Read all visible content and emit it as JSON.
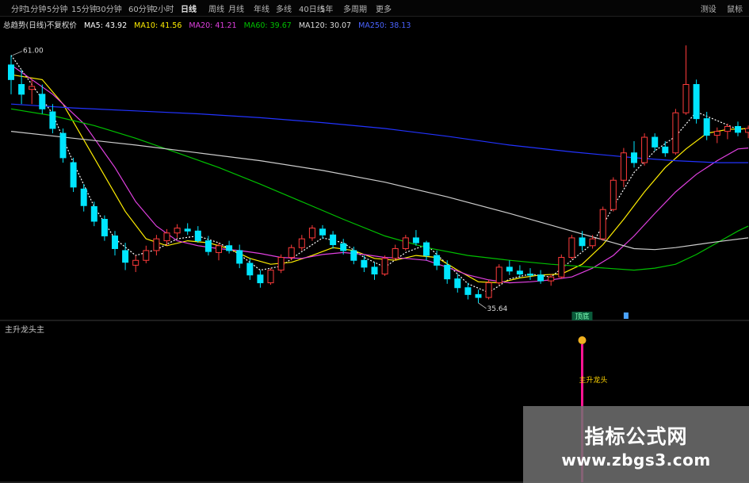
{
  "toolbar": {
    "items": [
      "分时",
      "1分钟",
      "5分钟",
      "15分钟",
      "30分钟",
      "60分钟",
      "2小时",
      "日线",
      "周线",
      "月线",
      "年线",
      "多线",
      "40日线",
      "5年",
      "多周期",
      "更多"
    ],
    "active_index": 7,
    "right_items": [
      "测设",
      "鼠标"
    ]
  },
  "legend": {
    "title": "总趋势(日线)不复权价",
    "ma5": "MA5: 43.92",
    "ma10": "MA10: 41.56",
    "ma20": "MA20: 41.21",
    "ma60": "MA60: 39.67",
    "ma120": "MA120: 30.07",
    "ma250": "MA250: 38.13"
  },
  "colors": {
    "up": "#ff3b3b",
    "down": "#00e5ff",
    "ma5": "#ffffff",
    "ma10": "#ffee00",
    "ma20": "#e040e0",
    "ma60": "#00c000",
    "ma120": "#cccccc",
    "ma250": "#2233ff",
    "signal": "#ff1493",
    "signal_text": "#ffd400"
  },
  "chart_data": {
    "type": "candlestick",
    "ylim": [
      34.5,
      63.4
    ],
    "max_label": "61.00",
    "min_label": "35.64",
    "marker_label": "顶底",
    "candles": [
      [
        60.0,
        61.0,
        57.0,
        58.5
      ],
      [
        58.0,
        59.5,
        56.0,
        57.0
      ],
      [
        57.5,
        58.5,
        56.0,
        57.8
      ],
      [
        57.0,
        58.0,
        55.0,
        55.5
      ],
      [
        55.2,
        56.0,
        53.0,
        53.5
      ],
      [
        53.0,
        53.5,
        50.0,
        50.5
      ],
      [
        50.0,
        50.5,
        47.0,
        47.5
      ],
      [
        47.3,
        47.8,
        45.0,
        45.6
      ],
      [
        45.5,
        46.0,
        43.5,
        44.0
      ],
      [
        44.2,
        44.6,
        42.0,
        42.5
      ],
      [
        42.5,
        43.0,
        40.5,
        41.2
      ],
      [
        41.0,
        41.8,
        39.0,
        39.8
      ],
      [
        39.5,
        40.5,
        38.8,
        40.0
      ],
      [
        40.0,
        41.5,
        39.7,
        41.0
      ],
      [
        41.0,
        42.6,
        40.5,
        42.2
      ],
      [
        42.0,
        43.2,
        41.5,
        42.8
      ],
      [
        42.8,
        43.7,
        42.3,
        43.3
      ],
      [
        43.2,
        43.8,
        42.6,
        43.0
      ],
      [
        43.0,
        43.5,
        41.8,
        42.0
      ],
      [
        42.0,
        42.5,
        40.5,
        40.9
      ],
      [
        40.8,
        41.8,
        40.0,
        41.5
      ],
      [
        41.5,
        42.0,
        40.7,
        41.0
      ],
      [
        41.0,
        41.6,
        39.2,
        39.7
      ],
      [
        39.7,
        40.2,
        38.0,
        38.5
      ],
      [
        38.5,
        39.0,
        37.2,
        37.7
      ],
      [
        37.7,
        39.2,
        37.5,
        39.0
      ],
      [
        39.0,
        40.6,
        38.7,
        40.3
      ],
      [
        40.3,
        41.6,
        40.0,
        41.3
      ],
      [
        41.3,
        42.6,
        41.0,
        42.2
      ],
      [
        42.3,
        43.6,
        42.0,
        43.3
      ],
      [
        43.2,
        43.6,
        42.2,
        42.6
      ],
      [
        42.6,
        43.0,
        41.2,
        41.6
      ],
      [
        41.7,
        42.2,
        40.6,
        41.0
      ],
      [
        41.0,
        41.4,
        39.6,
        40.0
      ],
      [
        40.0,
        40.5,
        38.8,
        39.3
      ],
      [
        39.3,
        39.8,
        38.0,
        38.6
      ],
      [
        38.6,
        40.5,
        38.4,
        40.2
      ],
      [
        40.2,
        41.6,
        40.0,
        41.2
      ],
      [
        41.2,
        42.6,
        41.0,
        42.3
      ],
      [
        42.3,
        43.1,
        41.5,
        41.8
      ],
      [
        41.8,
        42.0,
        40.0,
        40.5
      ],
      [
        40.5,
        41.0,
        39.0,
        39.5
      ],
      [
        39.5,
        40.0,
        37.6,
        38.1
      ],
      [
        38.1,
        38.6,
        36.7,
        37.2
      ],
      [
        37.2,
        37.7,
        36.0,
        36.5
      ],
      [
        36.5,
        37.0,
        35.64,
        36.2
      ],
      [
        36.2,
        38.0,
        36.0,
        37.7
      ],
      [
        37.7,
        39.6,
        37.5,
        39.3
      ],
      [
        39.3,
        40.0,
        38.5,
        38.9
      ],
      [
        38.9,
        39.5,
        38.2,
        38.6
      ],
      [
        38.6,
        39.2,
        38.0,
        38.5
      ],
      [
        38.5,
        39.0,
        37.6,
        37.9
      ],
      [
        37.9,
        38.6,
        37.4,
        38.3
      ],
      [
        38.3,
        40.6,
        38.1,
        40.3
      ],
      [
        40.3,
        42.6,
        40.1,
        42.3
      ],
      [
        42.3,
        43.0,
        41.0,
        41.5
      ],
      [
        41.5,
        42.6,
        41.2,
        42.2
      ],
      [
        42.2,
        45.5,
        42.0,
        45.2
      ],
      [
        45.2,
        48.5,
        45.0,
        48.2
      ],
      [
        48.2,
        51.5,
        47.5,
        51.0
      ],
      [
        51.0,
        52.2,
        49.5,
        50.0
      ],
      [
        50.0,
        53.0,
        49.7,
        52.6
      ],
      [
        52.6,
        53.0,
        51.2,
        51.6
      ],
      [
        51.6,
        52.2,
        50.6,
        51.0
      ],
      [
        51.0,
        55.5,
        50.8,
        55.1
      ],
      [
        55.1,
        62.0,
        54.9,
        58.0
      ],
      [
        58.0,
        58.5,
        54.0,
        54.5
      ],
      [
        54.5,
        55.2,
        52.3,
        52.8
      ],
      [
        52.8,
        53.6,
        52.0,
        53.2
      ],
      [
        53.2,
        54.0,
        52.4,
        53.7
      ],
      [
        53.7,
        54.2,
        52.7,
        53.1
      ],
      [
        53.1,
        53.8,
        52.5,
        53.5
      ]
    ],
    "ma_series": [
      {
        "name": "MA5",
        "points": [
          [
            0,
            61.0
          ],
          [
            2,
            58.0
          ],
          [
            4,
            55.0
          ],
          [
            6,
            50.0
          ],
          [
            8,
            45.5
          ],
          [
            10,
            42.2
          ],
          [
            12,
            40.5
          ],
          [
            14,
            41.1
          ],
          [
            16,
            42.2
          ],
          [
            18,
            42.5
          ],
          [
            20,
            41.8
          ],
          [
            22,
            40.6
          ],
          [
            24,
            39.0
          ],
          [
            26,
            39.4
          ],
          [
            28,
            40.9
          ],
          [
            30,
            42.3
          ],
          [
            32,
            41.8
          ],
          [
            34,
            40.3
          ],
          [
            36,
            39.3
          ],
          [
            38,
            40.8
          ],
          [
            40,
            41.6
          ],
          [
            42,
            39.6
          ],
          [
            44,
            37.6
          ],
          [
            46,
            36.7
          ],
          [
            48,
            38.1
          ],
          [
            50,
            38.6
          ],
          [
            52,
            38.3
          ],
          [
            54,
            40.0
          ],
          [
            56,
            41.7
          ],
          [
            58,
            45.5
          ],
          [
            60,
            49.0
          ],
          [
            62,
            51.2
          ],
          [
            64,
            52.7
          ],
          [
            66,
            55.2
          ],
          [
            68,
            54.3
          ],
          [
            70,
            53.4
          ],
          [
            71,
            53.5
          ]
        ]
      },
      {
        "name": "MA10",
        "points": [
          [
            0,
            59.0
          ],
          [
            3,
            58.5
          ],
          [
            5,
            56.0
          ],
          [
            8,
            50.5
          ],
          [
            11,
            45.0
          ],
          [
            13,
            42.2
          ],
          [
            15,
            41.5
          ],
          [
            17,
            42.0
          ],
          [
            19,
            41.8
          ],
          [
            21,
            41.2
          ],
          [
            23,
            40.2
          ],
          [
            25,
            39.6
          ],
          [
            27,
            39.8
          ],
          [
            29,
            40.5
          ],
          [
            31,
            41.3
          ],
          [
            33,
            41.0
          ],
          [
            35,
            40.2
          ],
          [
            37,
            40.0
          ],
          [
            39,
            40.5
          ],
          [
            41,
            40.3
          ],
          [
            43,
            39.0
          ],
          [
            45,
            37.8
          ],
          [
            47,
            37.7
          ],
          [
            49,
            38.2
          ],
          [
            51,
            38.5
          ],
          [
            53,
            38.6
          ],
          [
            55,
            39.6
          ],
          [
            57,
            41.6
          ],
          [
            59,
            44.2
          ],
          [
            61,
            47.0
          ],
          [
            63,
            49.5
          ],
          [
            65,
            51.4
          ],
          [
            67,
            53.0
          ],
          [
            69,
            53.4
          ],
          [
            71,
            53.5
          ]
        ]
      },
      {
        "name": "MA20",
        "points": [
          [
            0,
            60.0
          ],
          [
            4,
            57.0
          ],
          [
            7,
            54.0
          ],
          [
            10,
            49.5
          ],
          [
            12,
            46.0
          ],
          [
            14,
            43.5
          ],
          [
            16,
            42.0
          ],
          [
            18,
            41.5
          ],
          [
            20,
            41.2
          ],
          [
            22,
            41.0
          ],
          [
            24,
            40.7
          ],
          [
            26,
            40.3
          ],
          [
            28,
            40.2
          ],
          [
            30,
            40.6
          ],
          [
            32,
            40.8
          ],
          [
            34,
            40.6
          ],
          [
            36,
            40.3
          ],
          [
            38,
            40.2
          ],
          [
            40,
            40.0
          ],
          [
            42,
            39.3
          ],
          [
            44,
            38.5
          ],
          [
            46,
            38.0
          ],
          [
            48,
            37.7
          ],
          [
            50,
            37.8
          ],
          [
            52,
            38.0
          ],
          [
            54,
            38.3
          ],
          [
            56,
            39.2
          ],
          [
            58,
            40.5
          ],
          [
            60,
            42.5
          ],
          [
            62,
            44.8
          ],
          [
            64,
            47.0
          ],
          [
            66,
            48.8
          ],
          [
            68,
            50.2
          ],
          [
            70,
            51.4
          ],
          [
            71,
            51.5
          ]
        ]
      },
      {
        "name": "MA60",
        "points": [
          [
            0,
            55.5
          ],
          [
            4,
            54.8
          ],
          [
            8,
            53.8
          ],
          [
            12,
            52.5
          ],
          [
            16,
            51.0
          ],
          [
            20,
            49.5
          ],
          [
            24,
            47.8
          ],
          [
            28,
            46.0
          ],
          [
            32,
            44.2
          ],
          [
            36,
            42.5
          ],
          [
            40,
            41.3
          ],
          [
            44,
            40.5
          ],
          [
            48,
            40.0
          ],
          [
            52,
            39.6
          ],
          [
            56,
            39.3
          ],
          [
            60,
            39.0
          ],
          [
            62,
            39.2
          ],
          [
            64,
            39.6
          ],
          [
            66,
            40.6
          ],
          [
            68,
            41.8
          ],
          [
            70,
            43.0
          ],
          [
            71,
            43.5
          ]
        ]
      },
      {
        "name": "MA120",
        "points": [
          [
            0,
            53.2
          ],
          [
            6,
            52.5
          ],
          [
            12,
            51.8
          ],
          [
            18,
            51.0
          ],
          [
            24,
            50.2
          ],
          [
            30,
            49.2
          ],
          [
            36,
            48.0
          ],
          [
            42,
            46.5
          ],
          [
            48,
            44.8
          ],
          [
            54,
            43.0
          ],
          [
            58,
            41.8
          ],
          [
            60,
            41.2
          ],
          [
            62,
            41.1
          ],
          [
            64,
            41.3
          ],
          [
            66,
            41.6
          ],
          [
            68,
            41.9
          ],
          [
            71,
            42.3
          ]
        ]
      },
      {
        "name": "MA250",
        "points": [
          [
            0,
            56.0
          ],
          [
            6,
            55.6
          ],
          [
            12,
            55.3
          ],
          [
            18,
            55.0
          ],
          [
            24,
            54.6
          ],
          [
            30,
            54.1
          ],
          [
            36,
            53.5
          ],
          [
            42,
            52.7
          ],
          [
            48,
            51.8
          ],
          [
            54,
            51.1
          ],
          [
            60,
            50.5
          ],
          [
            64,
            50.2
          ],
          [
            68,
            50.0
          ],
          [
            71,
            50.0
          ]
        ]
      }
    ],
    "sub_indicator": {
      "title": "主升龙头主",
      "signal_index": 55,
      "signal_label": "主升龙头"
    }
  },
  "watermark": {
    "title": "指标公式网",
    "url": "www.zbgs3.com"
  }
}
